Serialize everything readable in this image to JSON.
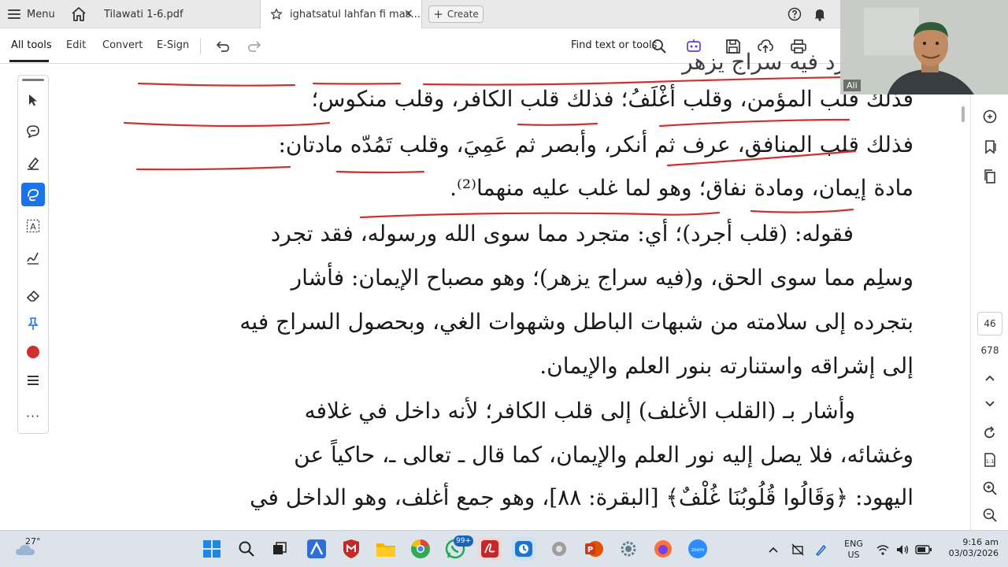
{
  "tabbar": {
    "menu_label": "Menu",
    "tabs": [
      {
        "label": "Tilawati 1-6.pdf"
      },
      {
        "label": "ighatsatul lahfan fi mas..."
      }
    ],
    "create_label": "Create"
  },
  "toolbar": {
    "items": [
      "All tools",
      "Edit",
      "Convert",
      "E-Sign"
    ],
    "find_label": "Find text or tools"
  },
  "document": {
    "lines": [
      "فذلك قلب المؤمن، وقلب أغْلَفُ؛ فذلك قلب الكافر، وقلب منكوس؛",
      "فذلك قلب المنافق، عرف ثم أنكر، وأبصر ثم عَمِيَ، وقلب تَمُدّه مادتان:",
      "مادة إيمان، ومادة نفاق؛ وهو لما غلب عليه منهما⁽²⁾.",
      "فقوله: (قلب أجرد)؛ أي: متجرد مما سوى الله ورسوله، فقد تجرد",
      "وسلِم مما سوى الحق، و(فيه سراج يزهر)؛ وهو مصباح الإيمان: فأشار",
      "بتجرده إلى سلامته من شبهات الباطل وشهوات الغي، وبحصول السراج فيه",
      "إلى إشراقه واستنارته بنور العلم والإيمان.",
      "وأشار بـ (القلب الأغلف) إلى قلب الكافر؛ لأنه داخل في غلافه",
      "وغشائه، فلا يصل إليه نور العلم والإيمان، كما قال ـ تعالى ـ، حاكياً عن",
      "اليهود: ﴿وَقَالُوا قُلُوبُنَا غُلْفٌ﴾ [البقرة: ٨٨]، وهو جمع أغلف، وهو الداخل في"
    ]
  },
  "right_rail": {
    "current_page": "46",
    "total_pages": "678"
  },
  "webcam": {
    "name": "Ali"
  },
  "taskbar": {
    "temperature": "27°",
    "whatsapp_badge": "99+",
    "language_line1": "ENG",
    "language_line2": "US",
    "time": "9:16 am",
    "date": "03/03/2026"
  },
  "colors": {
    "accent_blue": "#1a73e8",
    "annotation_red": "#d32f2f",
    "pdf_red": "#c62828"
  }
}
